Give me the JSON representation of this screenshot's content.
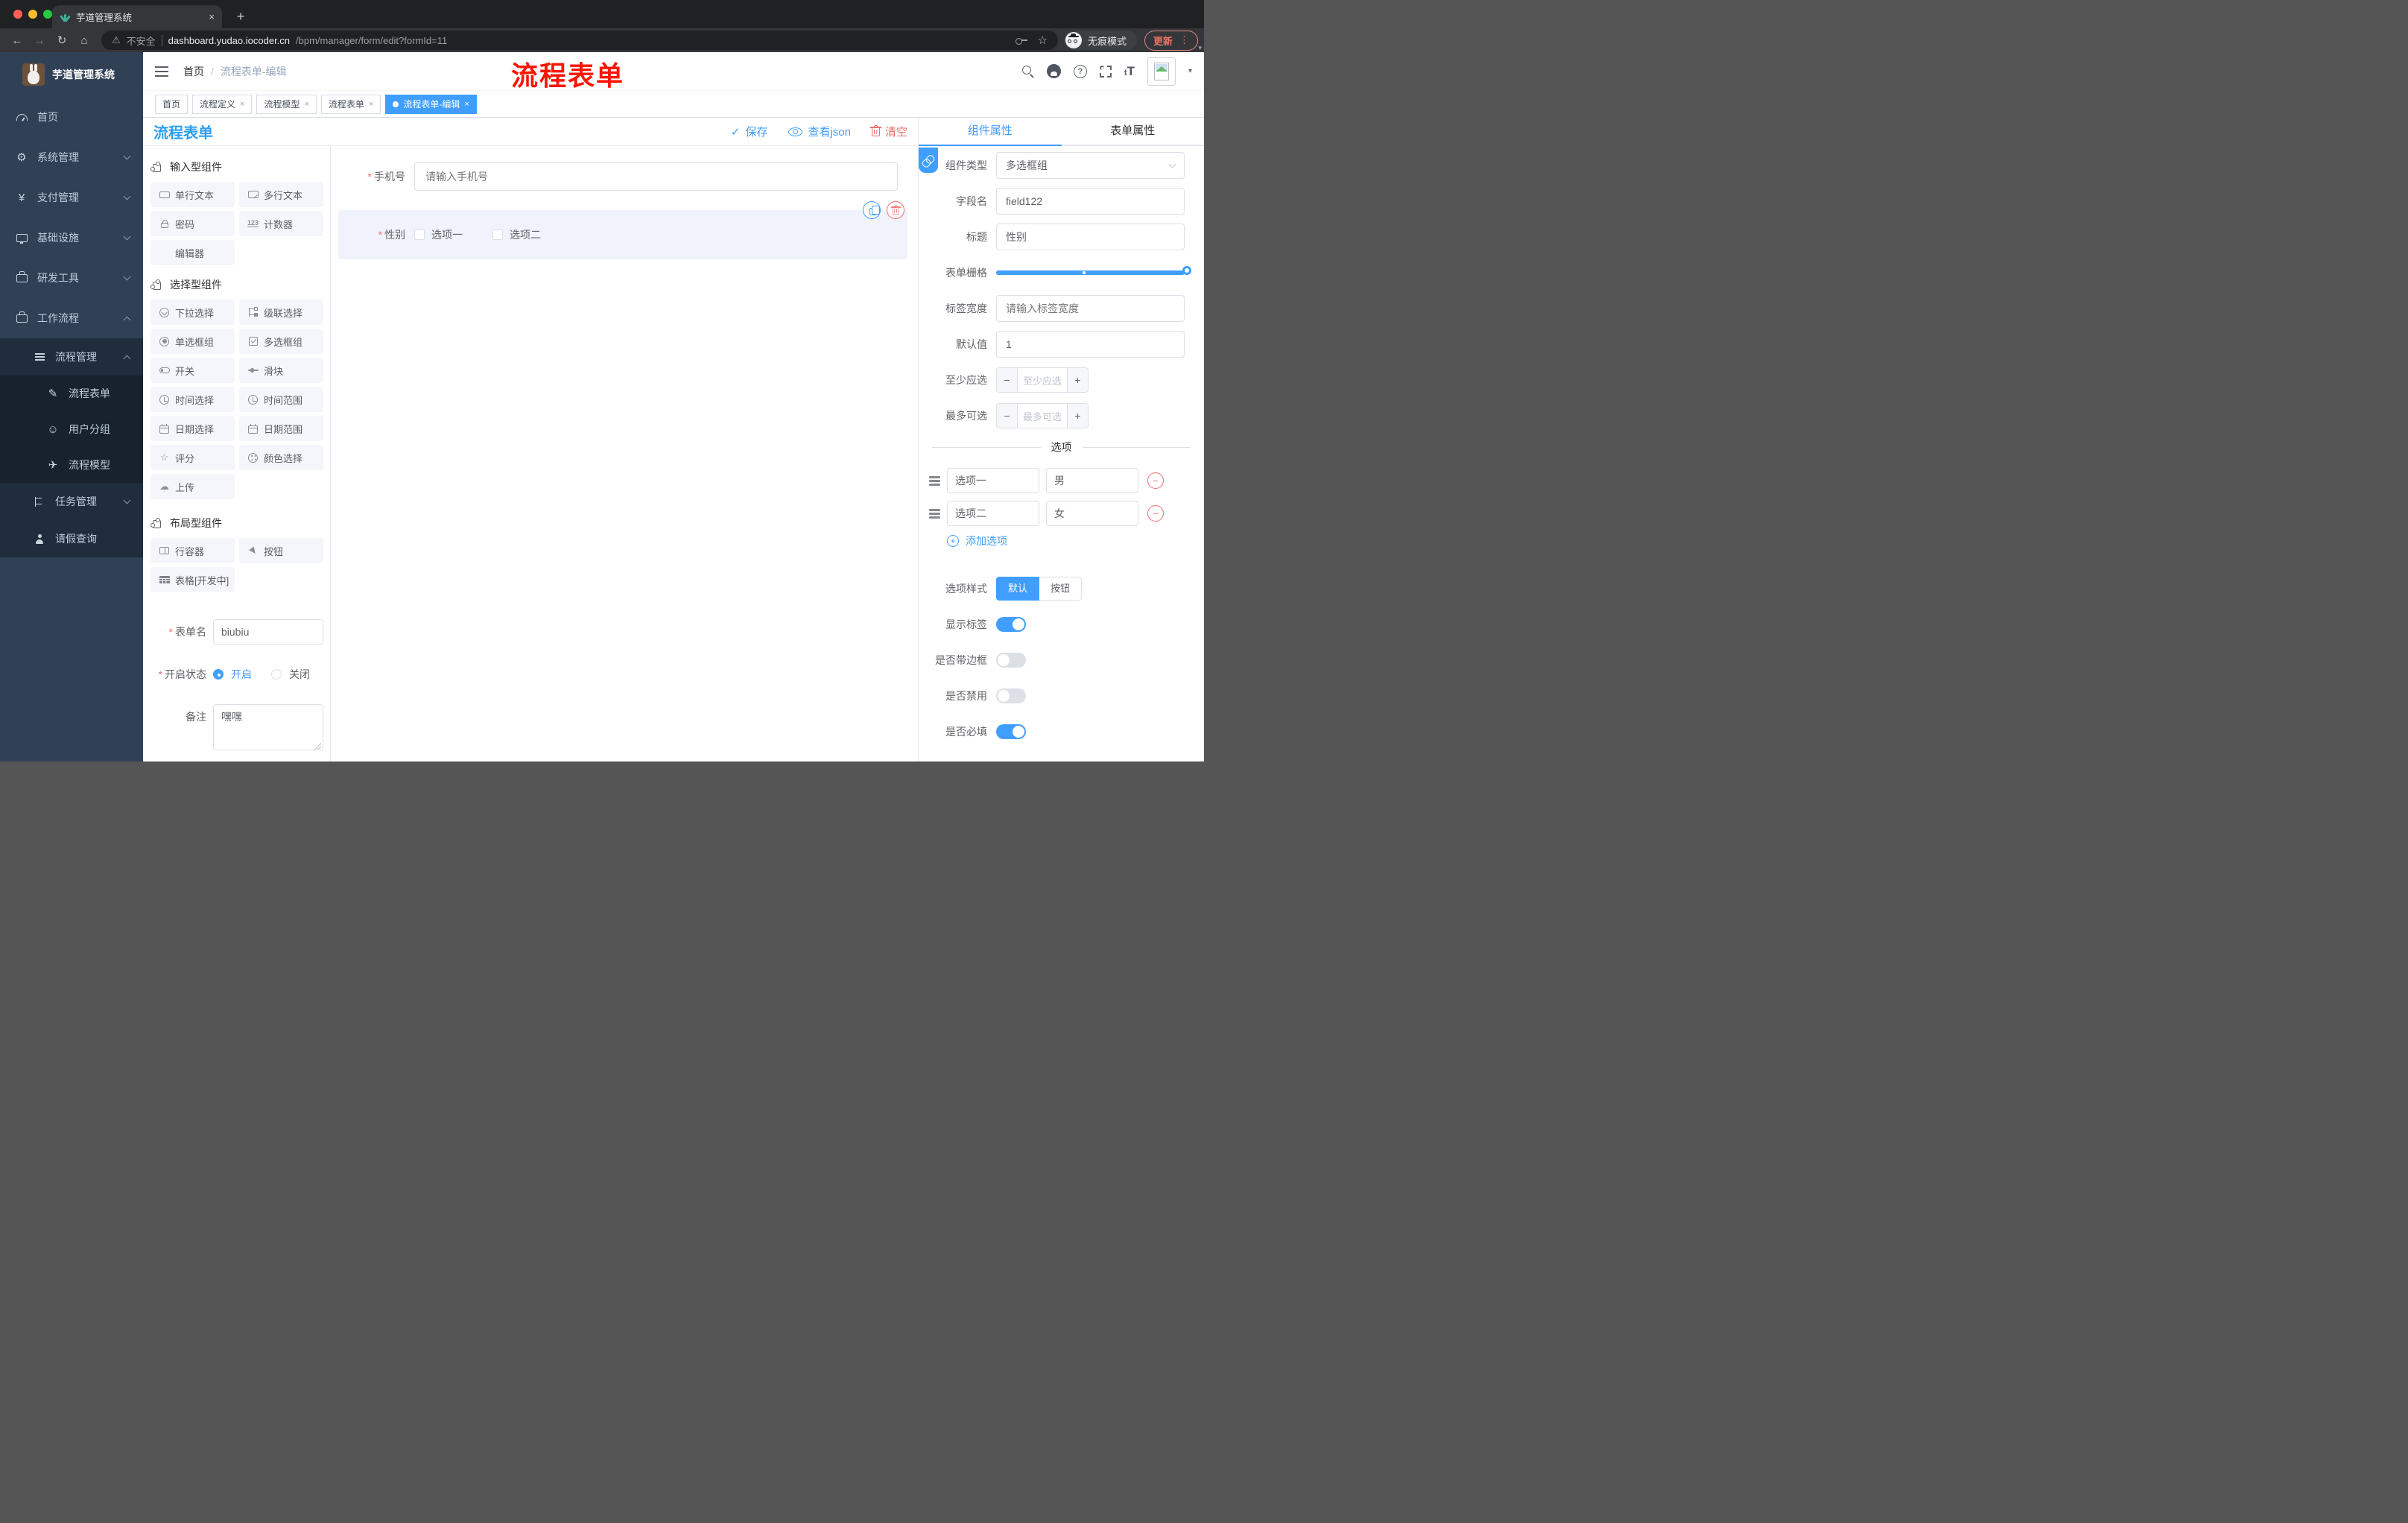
{
  "browser": {
    "tab_title": "芋道管理系统",
    "security_warning": "不安全",
    "url_host": "dashboard.yudao.iocoder.cn",
    "url_path": "/bpm/manager/form/edit?formId=11",
    "incognito_label": "无痕模式",
    "update_label": "更新"
  },
  "icons": {
    "back": "←",
    "forward": "→",
    "reload": "↻",
    "home": "⌂",
    "warning": "⚠",
    "star": "☆",
    "dots": "⋮",
    "caret": "▾",
    "close": "×",
    "plus": "+",
    "check": "✓",
    "help": "?",
    "minus": "−",
    "asterisk": "*",
    "font_size": "tT",
    "gear": "⚙",
    "yen": "¥",
    "pencil": "✎",
    "smile": "☺",
    "plane": "✈",
    "cloud": "☁",
    "up_arrow": "↑",
    "counter": "123",
    "rating_star": "☆"
  },
  "sidebar": {
    "brand": "芋道管理系统",
    "top_items": [
      {
        "label": "首页"
      },
      {
        "label": "系统管理"
      },
      {
        "label": "支付管理"
      },
      {
        "label": "基础设施"
      },
      {
        "label": "研发工具"
      },
      {
        "label": "工作流程"
      }
    ],
    "sub": {
      "process_mgmt": "流程管理",
      "children": [
        {
          "label": "流程表单"
        },
        {
          "label": "用户分组"
        },
        {
          "label": "流程模型"
        }
      ],
      "task_mgmt": "任务管理",
      "leave_query": "请假查询"
    }
  },
  "navbar": {
    "breadcrumb_home": "首页",
    "breadcrumb_sep": "/",
    "breadcrumb_current": "流程表单-编辑",
    "overlay_title": "流程表单"
  },
  "tags": [
    {
      "label": "首页"
    },
    {
      "label": "流程定义"
    },
    {
      "label": "流程模型"
    },
    {
      "label": "流程表单"
    },
    {
      "label": "流程表单-编辑"
    }
  ],
  "toolbar": {
    "title": "流程表单",
    "save": "保存",
    "view_json": "查看json",
    "clear": "清空"
  },
  "components": {
    "sections": [
      {
        "title": "输入型组件",
        "items": [
          {
            "label": "单行文本"
          },
          {
            "label": "多行文本"
          },
          {
            "label": "密码"
          },
          {
            "label": "计数器"
          },
          {
            "label": "编辑器"
          }
        ]
      },
      {
        "title": "选择型组件",
        "items": [
          {
            "label": "下拉选择"
          },
          {
            "label": "级联选择"
          },
          {
            "label": "单选框组"
          },
          {
            "label": "多选框组"
          },
          {
            "label": "开关"
          },
          {
            "label": "滑块"
          },
          {
            "label": "时间选择"
          },
          {
            "label": "时间范围"
          },
          {
            "label": "日期选择"
          },
          {
            "label": "日期范围"
          },
          {
            "label": "评分"
          },
          {
            "label": "颜色选择"
          },
          {
            "label": "上传"
          }
        ]
      },
      {
        "title": "布局型组件",
        "items": [
          {
            "label": "行容器"
          },
          {
            "label": "按钮"
          },
          {
            "label": "表格[开发中]"
          }
        ]
      }
    ],
    "meta": {
      "form_name_label": "表单名",
      "form_name_value": "biubiu",
      "status_label": "开启状态",
      "status_on": "开启",
      "status_off": "关闭",
      "remark_label": "备注",
      "remark_value": "嘿嘿"
    }
  },
  "canvas": {
    "phone_label": "手机号",
    "phone_placeholder": "请输入手机号",
    "gender_label": "性别",
    "gender_option1": "选项一",
    "gender_option2": "选项二"
  },
  "props": {
    "tab_component": "组件属性",
    "tab_form": "表单属性",
    "type_label": "组件类型",
    "type_value": "多选框组",
    "field_label": "字段名",
    "field_value": "field122",
    "title_label": "标题",
    "title_value": "性别",
    "grid_label": "表单栅格",
    "label_width_label": "标签宽度",
    "label_width_placeholder": "请输入标签宽度",
    "default_label": "默认值",
    "default_value": "1",
    "min_label": "至少应选",
    "min_placeholder": "至少应选",
    "max_label": "最多可选",
    "max_placeholder": "最多可选",
    "options_divider": "选项",
    "options": [
      {
        "name": "选项一",
        "value": "男"
      },
      {
        "name": "选项二",
        "value": "女"
      }
    ],
    "add_option": "添加选项",
    "style_label": "选项样式",
    "style_default": "默认",
    "style_button": "按钮",
    "show_label": "显示标签",
    "border_label": "是否带边框",
    "disabled_label": "是否禁用",
    "required_label": "是否必填"
  },
  "colors": {
    "primary": "#409eff",
    "danger": "#f56c6c",
    "title_blue": "#2b9ff2",
    "overlay_red": "#fb1503",
    "sidebar_bg": "#304156",
    "submenu_bg": "#1f2d3d"
  }
}
